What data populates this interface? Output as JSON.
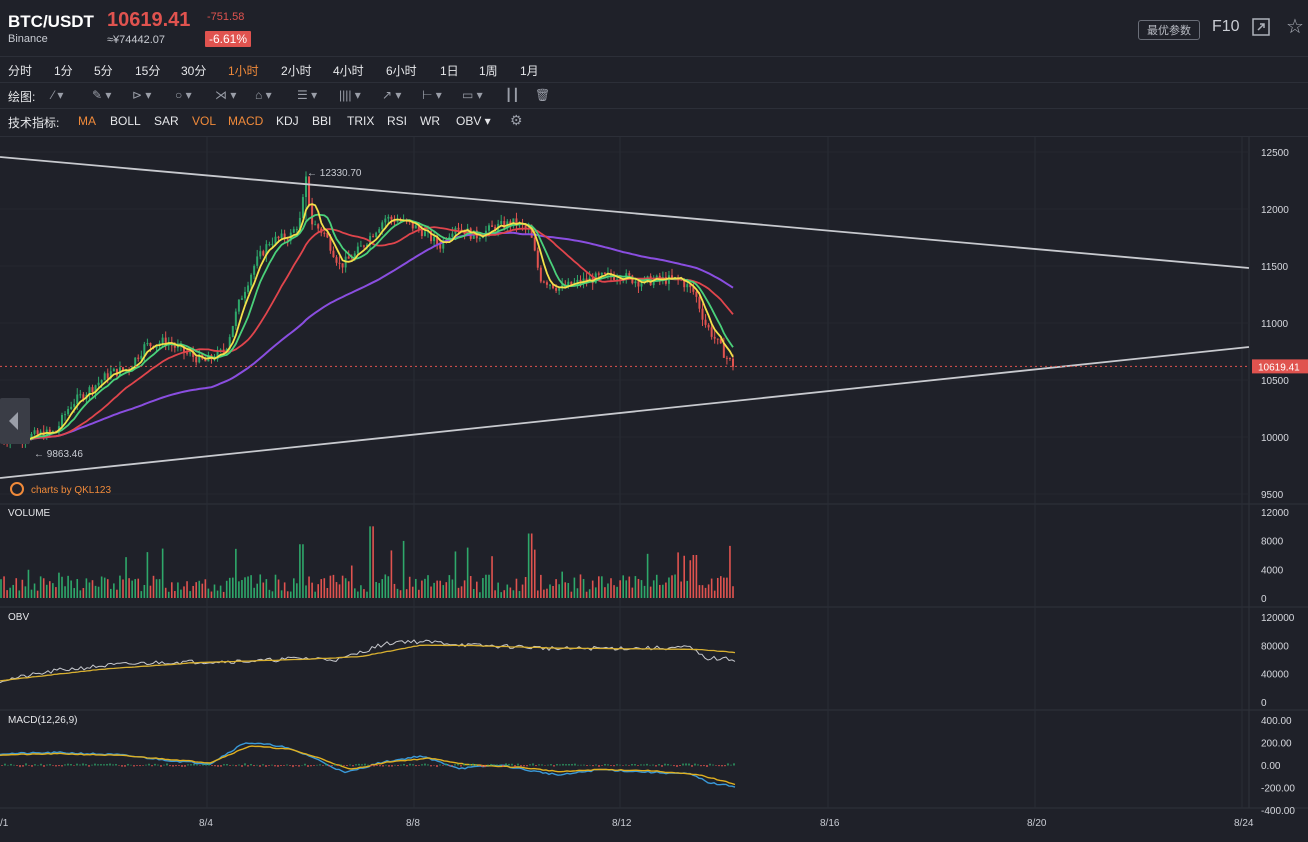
{
  "header": {
    "pair": "BTC/USDT",
    "exchange": "Binance",
    "price": "10619.41",
    "price_cny": "≈¥74442.07",
    "change": "-751.58",
    "change_pct": "-6.61%",
    "params_label": "最优参数",
    "f10_label": "F10"
  },
  "intervals": [
    "分时",
    "1分",
    "5分",
    "15分",
    "30分",
    "1小时",
    "2小时",
    "4小时",
    "6小时",
    "1日",
    "1周",
    "1月"
  ],
  "active_interval": "1小时",
  "drawing": {
    "label": "绘图:",
    "tools": [
      "line-tool-icon",
      "pen-tool-icon",
      "channel-tool-icon",
      "circle-tool-icon",
      "fork-tool-icon",
      "pattern-tool-icon",
      "fib-tool-icon",
      "bars-tool-icon",
      "arrow-tool-icon",
      "measure-tool-icon",
      "note-tool-icon",
      "indicator-tool-icon",
      "trash-icon"
    ]
  },
  "indicators": {
    "label": "技术指标:",
    "items": [
      "MA",
      "BOLL",
      "SAR",
      "VOL",
      "MACD",
      "KDJ",
      "BBI",
      "TRIX",
      "RSI",
      "WR",
      "OBV ▾"
    ],
    "active": [
      "MA",
      "VOL",
      "MACD"
    ]
  },
  "main_chart": {
    "yticks": [
      "12500",
      "12000",
      "11500",
      "11000",
      "10500",
      "10000",
      "9500"
    ],
    "high_label": "← 12330.70",
    "low_label": "← 9863.46",
    "last_price": "10619.41",
    "watermark": "charts by QKL123"
  },
  "volume": {
    "title": "VOLUME",
    "yticks": [
      "12000",
      "8000",
      "4000",
      "0"
    ]
  },
  "obv": {
    "title": "OBV",
    "yticks": [
      "120000",
      "80000",
      "40000",
      "0"
    ]
  },
  "macd": {
    "title": "MACD(12,26,9)",
    "yticks": [
      "400.00",
      "200.00",
      "0.00",
      "-200.00",
      "-400.00"
    ]
  },
  "xaxis": {
    "labels": [
      "/1",
      "8/4",
      "8/8",
      "8/12",
      "8/16",
      "8/20",
      "8/24"
    ]
  },
  "colors": {
    "up": "#2ea86a",
    "down": "#e0534f",
    "ma1": "#f3e04a",
    "ma2": "#4ad17a",
    "ma3": "#e0454c",
    "ma4": "#8a4ee0",
    "accent": "#f08a3a"
  },
  "chart_data": {
    "type": "candlestick",
    "x": [
      "8/1",
      "8/2",
      "8/3",
      "8/4",
      "8/5",
      "8/6",
      "8/7",
      "8/8",
      "8/9",
      "8/10",
      "8/11",
      "8/12",
      "8/13",
      "8/14"
    ],
    "close": [
      9950,
      10050,
      10500,
      10750,
      11500,
      11900,
      11600,
      11950,
      11900,
      11850,
      11350,
      11400,
      11350,
      10619.41
    ],
    "high_marker": 12330.7,
    "low_marker": 9863.46,
    "ylim": [
      9400,
      12650
    ]
  }
}
